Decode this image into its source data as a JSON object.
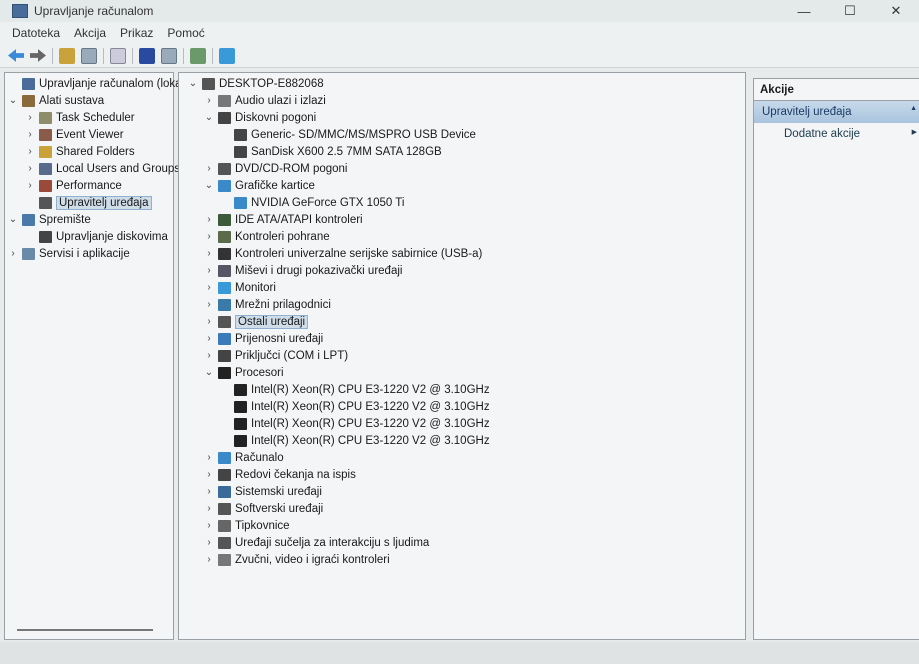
{
  "window": {
    "title": "Upravljanje računalom",
    "minimize": "—",
    "maximize": "☐",
    "close": "✕"
  },
  "menu": [
    "Datoteka",
    "Akcija",
    "Prikaz",
    "Pomoć"
  ],
  "left_tree": [
    {
      "label": "Upravljanje računalom (lokalno",
      "level": 0,
      "chev": "",
      "color": "#4a6c9a"
    },
    {
      "label": "Alati sustava",
      "level": 0,
      "chev": "⌄",
      "color": "#8a6a3a"
    },
    {
      "label": "Task Scheduler",
      "level": 1,
      "chev": "›",
      "color": "#8d8d6a"
    },
    {
      "label": "Event Viewer",
      "level": 1,
      "chev": "›",
      "color": "#8a5a4a"
    },
    {
      "label": "Shared Folders",
      "level": 1,
      "chev": "›",
      "color": "#c9a23a"
    },
    {
      "label": "Local Users and Groups",
      "level": 1,
      "chev": "›",
      "color": "#5a6a8a"
    },
    {
      "label": "Performance",
      "level": 1,
      "chev": "›",
      "color": "#9a4a3a"
    },
    {
      "label": "Upravitelj uređaja",
      "level": 1,
      "chev": "",
      "color": "#555",
      "selected": true
    },
    {
      "label": "Spremište",
      "level": 0,
      "chev": "⌄",
      "color": "#4a7aaa"
    },
    {
      "label": "Upravljanje diskovima",
      "level": 1,
      "chev": "",
      "color": "#444"
    },
    {
      "label": "Servisi i aplikacije",
      "level": 0,
      "chev": "›",
      "color": "#6a8aaa"
    }
  ],
  "device_tree": [
    {
      "label": "DESKTOP-E882068",
      "level": 0,
      "chev": "⌄",
      "color": "#555"
    },
    {
      "label": "Audio ulazi i izlazi",
      "level": 1,
      "chev": "›",
      "color": "#777"
    },
    {
      "label": "Diskovni pogoni",
      "level": 1,
      "chev": "⌄",
      "color": "#444"
    },
    {
      "label": "Generic- SD/MMC/MS/MSPRO USB Device",
      "level": 2,
      "chev": "",
      "color": "#444"
    },
    {
      "label": "SanDisk X600 2.5 7MM SATA 128GB",
      "level": 2,
      "chev": "",
      "color": "#444"
    },
    {
      "label": "DVD/CD-ROM pogoni",
      "level": 1,
      "chev": "›",
      "color": "#555"
    },
    {
      "label": "Grafičke kartice",
      "level": 1,
      "chev": "⌄",
      "color": "#3a8ac9"
    },
    {
      "label": "NVIDIA GeForce GTX 1050 Ti",
      "level": 2,
      "chev": "",
      "color": "#3a8ac9"
    },
    {
      "label": "IDE ATA/ATAPI kontroleri",
      "level": 1,
      "chev": "›",
      "color": "#3a5a3a"
    },
    {
      "label": "Kontroleri pohrane",
      "level": 1,
      "chev": "›",
      "color": "#5a6a4a"
    },
    {
      "label": "Kontroleri univerzalne serijske sabirnice (USB-a)",
      "level": 1,
      "chev": "›",
      "color": "#333"
    },
    {
      "label": "Miševi i drugi pokazivački uređaji",
      "level": 1,
      "chev": "›",
      "color": "#556"
    },
    {
      "label": "Monitori",
      "level": 1,
      "chev": "›",
      "color": "#3a9ad9"
    },
    {
      "label": "Mrežni prilagodnici",
      "level": 1,
      "chev": "›",
      "color": "#3a7aa9"
    },
    {
      "label": "Ostali uređaji",
      "level": 1,
      "chev": "›",
      "color": "#555",
      "selected": true
    },
    {
      "label": "Prijenosni uređaji",
      "level": 1,
      "chev": "›",
      "color": "#3a7ab9"
    },
    {
      "label": "Priključci (COM i LPT)",
      "level": 1,
      "chev": "›",
      "color": "#444"
    },
    {
      "label": "Procesori",
      "level": 1,
      "chev": "⌄",
      "color": "#222"
    },
    {
      "label": "Intel(R) Xeon(R) CPU E3-1220 V2 @ 3.10GHz",
      "level": 2,
      "chev": "",
      "color": "#222"
    },
    {
      "label": "Intel(R) Xeon(R) CPU E3-1220 V2 @ 3.10GHz",
      "level": 2,
      "chev": "",
      "color": "#222"
    },
    {
      "label": "Intel(R) Xeon(R) CPU E3-1220 V2 @ 3.10GHz",
      "level": 2,
      "chev": "",
      "color": "#222"
    },
    {
      "label": "Intel(R) Xeon(R) CPU E3-1220 V2 @ 3.10GHz",
      "level": 2,
      "chev": "",
      "color": "#222"
    },
    {
      "label": "Računalo",
      "level": 1,
      "chev": "›",
      "color": "#3a8ac9"
    },
    {
      "label": "Redovi čekanja na ispis",
      "level": 1,
      "chev": "›",
      "color": "#444"
    },
    {
      "label": "Sistemski uređaji",
      "level": 1,
      "chev": "›",
      "color": "#3a6a9a"
    },
    {
      "label": "Softverski uređaji",
      "level": 1,
      "chev": "›",
      "color": "#555"
    },
    {
      "label": "Tipkovnice",
      "level": 1,
      "chev": "›",
      "color": "#666"
    },
    {
      "label": "Uređaji sučelja za interakciju s ljudima",
      "level": 1,
      "chev": "›",
      "color": "#555"
    },
    {
      "label": "Zvučni, video i igraći kontroleri",
      "level": 1,
      "chev": "›",
      "color": "#777"
    }
  ],
  "actions": {
    "header": "Akcije",
    "section": "Upravitelj uređaja",
    "item": "Dodatne akcije"
  }
}
